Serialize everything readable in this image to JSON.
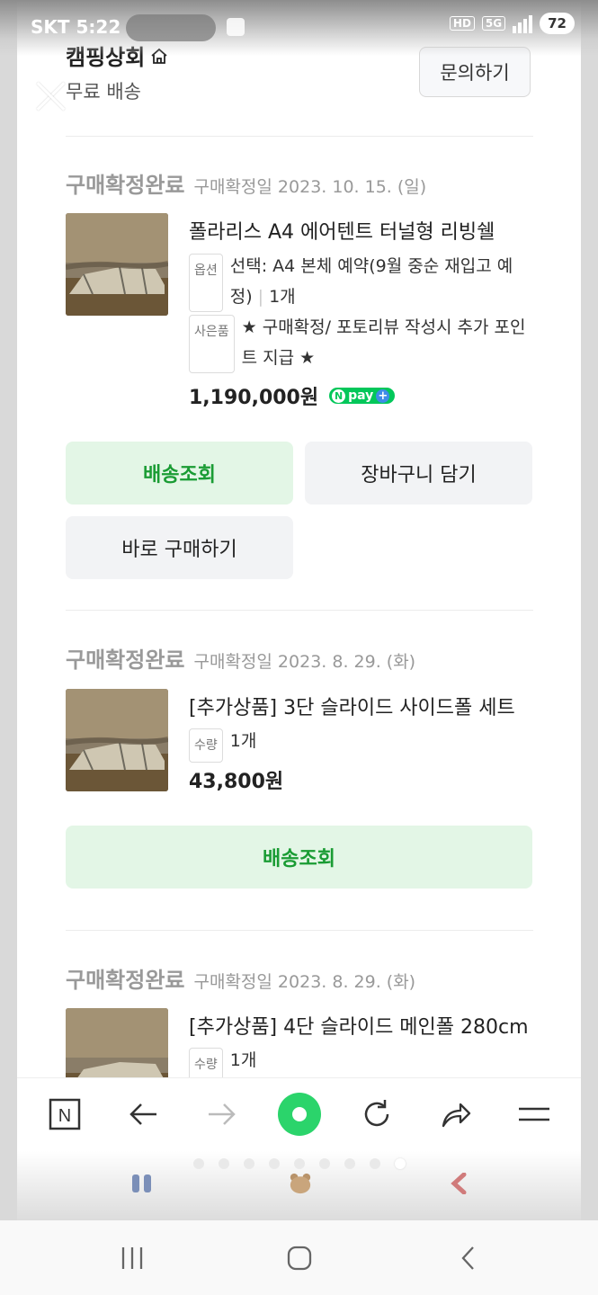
{
  "status_bar": {
    "carrier": "SKT",
    "time": "5:22",
    "battery": "72",
    "network": "5G",
    "hd_label": "HD"
  },
  "store": {
    "name": "캠핑상회",
    "shipping": "무료 배송",
    "inquiry_label": "문의하기"
  },
  "orders": [
    {
      "status": "구매확정완료",
      "confirm_date": "구매확정일 2023. 10. 15. (일)",
      "product_name": "폴라리스 A4 에어텐트 터널형 리빙쉘",
      "option_tag": "옵션",
      "option_text": "선택: A4 본체 예약(9월 중순 재입고 예정)",
      "quantity": "1개",
      "gift_tag": "사은품",
      "gift_text": "★ 구매확정/ 포토리뷰 작성시 추가 포인트 지급 ★",
      "price": "1,190,000원",
      "buttons": {
        "track": "배송조회",
        "cart": "장바구니 담기",
        "buy_now": "바로 구매하기"
      }
    },
    {
      "status": "구매확정완료",
      "confirm_date": "구매확정일 2023. 8. 29. (화)",
      "product_name": "[추가상품] 3단 슬라이드 사이드폴 세트",
      "qty_tag": "수량",
      "quantity": "1개",
      "price": "43,800원",
      "buttons": {
        "track": "배송조회"
      }
    },
    {
      "status": "구매확정완료",
      "confirm_date": "구매확정일 2023. 8. 29. (화)",
      "product_name": "[추가상품] 4단 슬라이드 메인폴 280cm",
      "qty_tag": "수량",
      "quantity": "1개"
    }
  ],
  "npay": {
    "label": "pay",
    "n": "N",
    "plus": "+"
  },
  "toolbar": {
    "icons": [
      "naver-n-icon",
      "back-arrow-icon",
      "forward-arrow-icon",
      "home-green-circle-icon",
      "refresh-icon",
      "share-icon",
      "menu-icon"
    ],
    "naver_letter": "N"
  },
  "colors": {
    "accent_green": "#03c75a",
    "button_green_bg": "#e3f6e6",
    "button_green_text": "#1a9c34"
  }
}
